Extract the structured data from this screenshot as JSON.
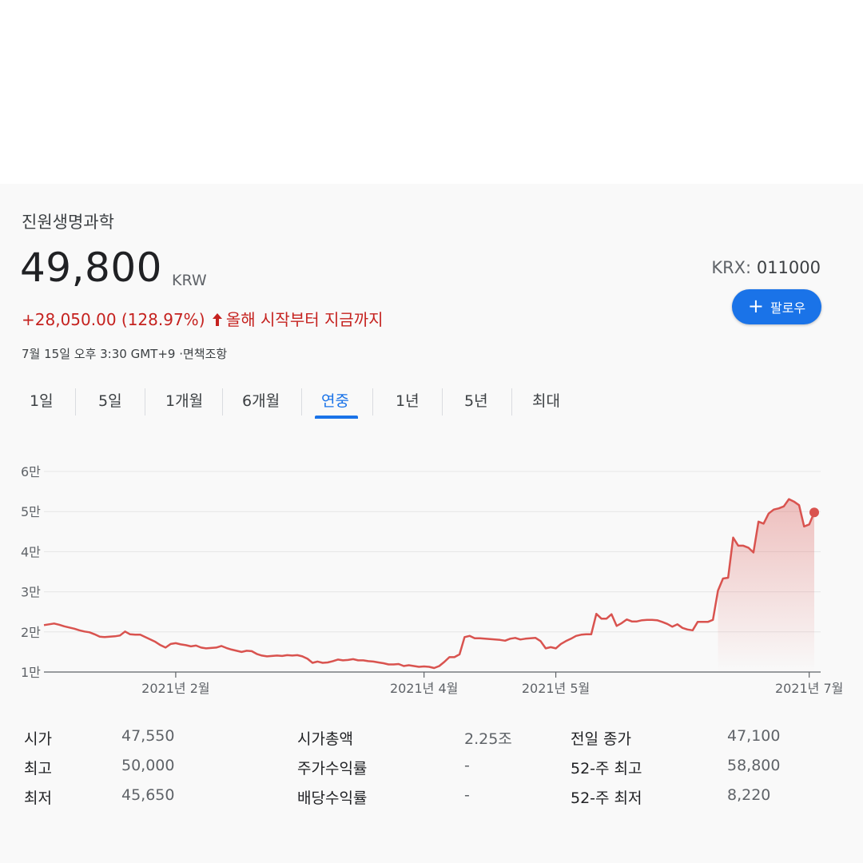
{
  "stock": {
    "name": "진원생명과학",
    "price": "49,800",
    "currency": "KRW",
    "change": "+28,050.00 (128.97%)",
    "change_period": "올해 시작부터 지금까지",
    "timestamp": "7월 15일 오후 3:30 GMT+9 ·면책조항",
    "exchange_label": "KRX:",
    "ticker_code": "011000",
    "follow_label": "팔로우"
  },
  "tabs": [
    {
      "label": "1일",
      "active": false
    },
    {
      "label": "5일",
      "active": false
    },
    {
      "label": "1개월",
      "active": false
    },
    {
      "label": "6개월",
      "active": false
    },
    {
      "label": "연중",
      "active": true
    },
    {
      "label": "1년",
      "active": false
    },
    {
      "label": "5년",
      "active": false
    },
    {
      "label": "최대",
      "active": false
    }
  ],
  "colors": {
    "accent": "#1a73e8",
    "negative_red": "#c5221f",
    "line": "#d9534f"
  },
  "icons": {
    "change_arrow": "arrow-up-icon",
    "follow": "plus-icon",
    "last_point": "current-price-dot"
  },
  "chart_data": {
    "type": "area",
    "title": "",
    "xlabel": "",
    "ylabel": "",
    "ylim": [
      10000,
      60000
    ],
    "y_ticks": [
      {
        "value": 60000,
        "label": "6만"
      },
      {
        "value": 50000,
        "label": "5만"
      },
      {
        "value": 40000,
        "label": "4만"
      },
      {
        "value": 30000,
        "label": "3만"
      },
      {
        "value": 20000,
        "label": "2만"
      },
      {
        "value": 10000,
        "label": "1만"
      }
    ],
    "x_ticks": [
      {
        "label": "2021년 2월",
        "index": 26
      },
      {
        "label": "2021년 4월",
        "index": 75
      },
      {
        "label": "2021년 5월",
        "index": 101
      },
      {
        "label": "2021년 7월",
        "index": 151
      }
    ],
    "grid": true,
    "series": [
      {
        "values": [
          21700,
          21900,
          22100,
          21800,
          21400,
          21100,
          20800,
          20400,
          20100,
          19900,
          19400,
          18800,
          18700,
          18800,
          18900,
          19100,
          20100,
          19400,
          19300,
          19300,
          18700,
          18100,
          17500,
          16700,
          16100,
          17000,
          17200,
          16900,
          16700,
          16400,
          16600,
          16100,
          15900,
          16000,
          16100,
          16500,
          16000,
          15600,
          15300,
          15000,
          15300,
          15200,
          14500,
          14100,
          13900,
          14000,
          14100,
          14000,
          14200,
          14100,
          14200,
          13900,
          13300,
          12300,
          12600,
          12300,
          12400,
          12700,
          13100,
          12900,
          13000,
          13200,
          12900,
          12900,
          12700,
          12600,
          12400,
          12200,
          11900,
          11900,
          12000,
          11500,
          11700,
          11500,
          11300,
          11400,
          11300,
          11000,
          11500,
          12500,
          13700,
          13700,
          14400,
          18700,
          19000,
          18400,
          18400,
          18300,
          18200,
          18100,
          18000,
          17800,
          18300,
          18500,
          18100,
          18300,
          18400,
          18500,
          17700,
          15900,
          16200,
          15900,
          17000,
          17700,
          18300,
          19000,
          19300,
          19400,
          19400,
          24500,
          23300,
          23300,
          24400,
          21500,
          22200,
          23100,
          22600,
          22600,
          22900,
          23000,
          23000,
          22900,
          22500,
          22000,
          21300,
          21900,
          21000,
          20600,
          20400,
          22500,
          22500,
          22500,
          23000,
          30300,
          33300,
          33500,
          43500,
          41500,
          41500,
          41000,
          39800,
          47500,
          47000,
          49500,
          50500,
          50800,
          51300,
          53100,
          52500,
          51600,
          46300,
          46800,
          49800
        ]
      }
    ]
  },
  "stats": [
    [
      {
        "label": "시가",
        "value": "47,550"
      },
      {
        "label": "최고",
        "value": "50,000"
      },
      {
        "label": "최저",
        "value": "45,650"
      }
    ],
    [
      {
        "label": "시가총액",
        "value": "2.25조"
      },
      {
        "label": "주가수익률",
        "value": "-"
      },
      {
        "label": "배당수익률",
        "value": "-"
      }
    ],
    [
      {
        "label": "전일 종가",
        "value": "47,100"
      },
      {
        "label": "52-주 최고",
        "value": "58,800"
      },
      {
        "label": "52-주 최저",
        "value": "8,220"
      }
    ]
  ]
}
